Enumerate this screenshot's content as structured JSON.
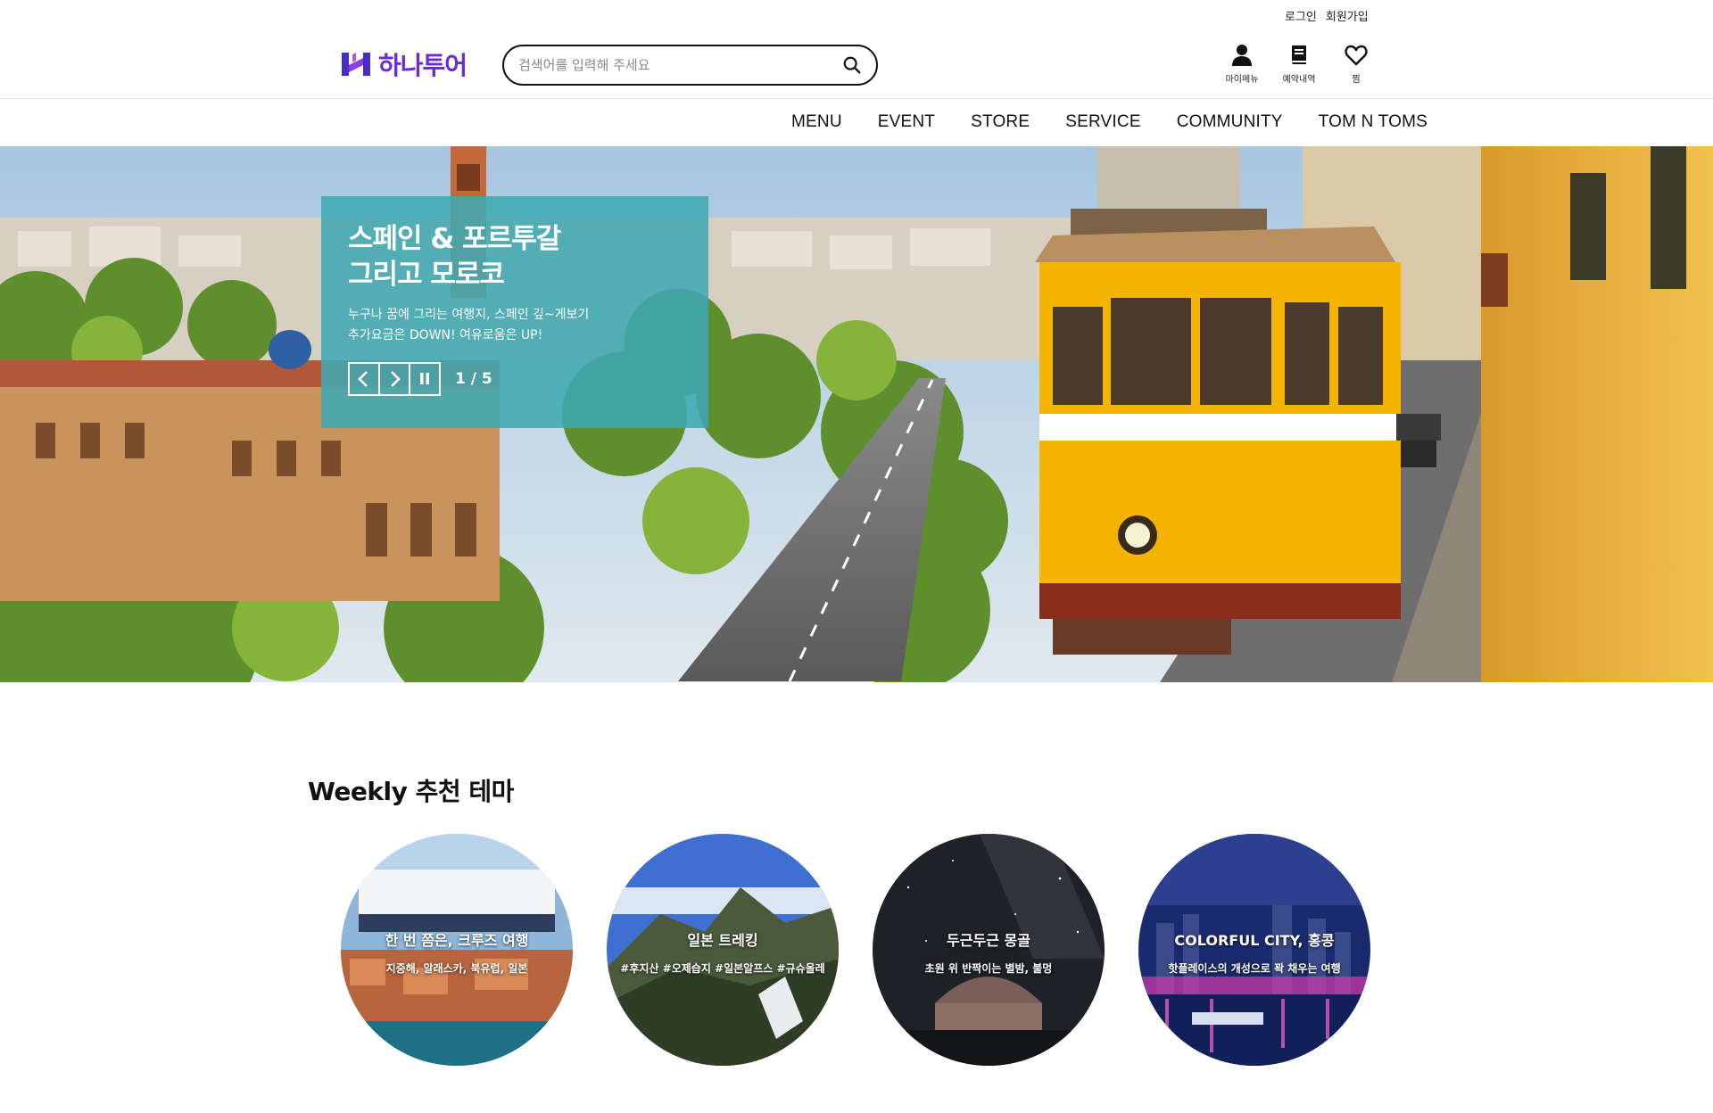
{
  "top_links": {
    "login": "로그인",
    "signup": "회원가입"
  },
  "logo": {
    "text": "하나투어"
  },
  "search": {
    "placeholder": "검색어를 입력해 주세요"
  },
  "utility": [
    {
      "label": "마이메뉴",
      "icon": "person-icon"
    },
    {
      "label": "예약내역",
      "icon": "book-icon"
    },
    {
      "label": "찜",
      "icon": "heart-icon"
    }
  ],
  "nav": [
    "MENU",
    "EVENT",
    "STORE",
    "SERVICE",
    "COMMUNITY",
    "TOM N TOMS"
  ],
  "hero": {
    "title": "스페인 & 포르투갈\n그리고 모로코",
    "desc": "누구나 꿈에 그리는 여행지, 스페인 깊~게보기\n추가요금은 DOWN!  여유로움은 UP!",
    "pager": "1 / 5",
    "panel_color": "#40a8b2"
  },
  "weekly": {
    "title": "Weekly 추천 테마",
    "items": [
      {
        "title": "한 번 쯤은, 크루즈 여행",
        "sub": "지중해, 알래스카, 북유럽, 일본"
      },
      {
        "title": "일본 트레킹",
        "sub": "#후지산 #오제습지 #일본알프스 #규슈올레"
      },
      {
        "title": "두근두근 몽골",
        "sub": "초원 위 반짝이는 별밤, 불멍"
      },
      {
        "title": "COLORFUL CITY, 홍콩",
        "sub": "핫플레이스의 개성으로 꽉 채우는 여행"
      }
    ]
  },
  "colors": {
    "brand": "#6a2bd3",
    "tram_yellow": "#f4b400"
  }
}
